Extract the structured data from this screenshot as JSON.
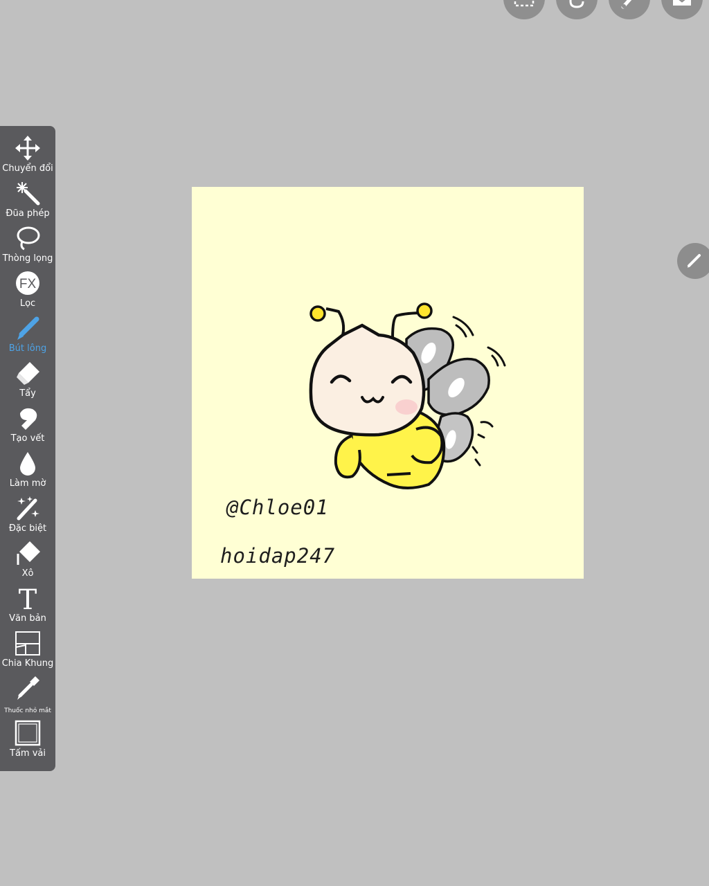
{
  "app": {
    "top_buttons": [
      {
        "icon": "selection-icon"
      },
      {
        "icon": "undo-icon"
      },
      {
        "icon": "brush-settings-icon"
      },
      {
        "icon": "layers-icon"
      }
    ],
    "edit_button_icon": "pencil-icon"
  },
  "toolbar": {
    "active_tool": "brush",
    "colors": {
      "background": "#5a5a5d",
      "label": "#ffffff",
      "active": "#4ea3e6"
    },
    "tools": [
      {
        "id": "transform",
        "label": "Chuyển đổi",
        "icon": "move-arrows-icon"
      },
      {
        "id": "magic-wand",
        "label": "Đũa phép",
        "icon": "magic-wand-icon"
      },
      {
        "id": "lasso",
        "label": "Thòng lọng",
        "icon": "lasso-icon"
      },
      {
        "id": "filter",
        "label": "Lọc",
        "icon": "fx-icon",
        "icon_text": "FX"
      },
      {
        "id": "brush",
        "label": "Bút lông",
        "icon": "brush-icon"
      },
      {
        "id": "eraser",
        "label": "Tẩy",
        "icon": "eraser-icon"
      },
      {
        "id": "smudge",
        "label": "Tạo vết",
        "icon": "smudge-icon"
      },
      {
        "id": "blur",
        "label": "Làm mờ",
        "icon": "blur-drop-icon"
      },
      {
        "id": "special",
        "label": "Đặc biệt",
        "icon": "sparkle-wand-icon"
      },
      {
        "id": "bucket",
        "label": "Xô",
        "icon": "paint-bucket-icon"
      },
      {
        "id": "text",
        "label": "Văn bản",
        "icon": "text-icon",
        "icon_text": "T"
      },
      {
        "id": "frame-divider",
        "label": "Chia Khung",
        "icon": "frame-divider-icon"
      },
      {
        "id": "eyedropper",
        "label": "Thuốc nhỏ mắt",
        "icon": "eyedropper-icon"
      },
      {
        "id": "canvas",
        "label": "Tấm vải",
        "icon": "canvas-icon"
      }
    ]
  },
  "canvas": {
    "background": "#ffffd4",
    "artwork": "bee-drawing",
    "signature_1": "@Chloe01",
    "signature_2": "hoidap247"
  }
}
